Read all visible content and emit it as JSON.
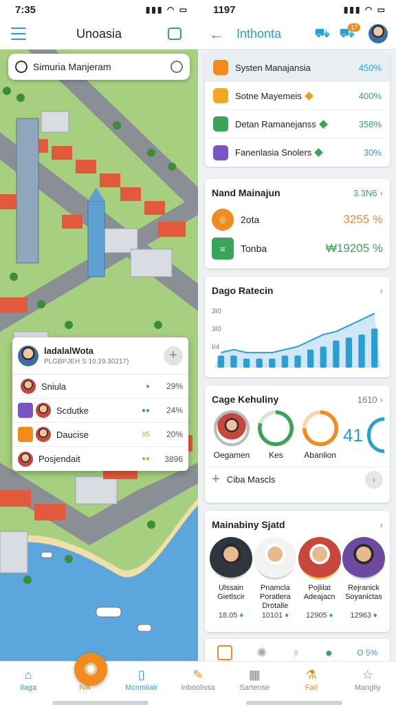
{
  "status": {
    "left_time": "7:35",
    "right_time": "1197"
  },
  "left_header": {
    "title": "Unoasia"
  },
  "right_header": {
    "title": "Inthonta",
    "badge": "17"
  },
  "search": {
    "text": "Simuria Manjeram"
  },
  "popup": {
    "name": "ladalalWota",
    "subtitle": "PLGBPJEH S 10.19.30217)",
    "rows": [
      {
        "label": "Sniula",
        "value": "29%",
        "dot_color": "#888888"
      },
      {
        "label": "Scdutke",
        "value": "24%",
        "dot_color": "#3aa55a",
        "icon_color": "#7b56c2"
      },
      {
        "label": "Daucise",
        "value": "20%",
        "dot_color": "#e8a21c",
        "dot_text": "85",
        "icon_color": "#f28a1d"
      },
      {
        "label": "Posjendait",
        "value": "3896",
        "dot_color": "#e8a21c"
      }
    ]
  },
  "systems": [
    {
      "label": "Systen Manajansia",
      "value": "450%",
      "icon_color": "#f28a1d",
      "value_color": "#2a9fd6"
    },
    {
      "label": "Sotne Mayemeis",
      "value": "400%",
      "icon_color": "#f5a623",
      "value_color": "#3aa55a",
      "diamond_color": "#e8a21c"
    },
    {
      "label": "Detan Ramanejanss",
      "value": "358%",
      "icon_color": "#3aa55a",
      "value_color": "#3aa55a",
      "diamond_color": "#3aa55a"
    },
    {
      "label": "Fanenlasia Snolers",
      "value": "30%",
      "icon_color": "#7b56c2",
      "value_color": "#2a9fd6",
      "diamond_color": "#3aa55a"
    }
  ],
  "main_card": {
    "title": "Nand Mainajun",
    "value": "3.3N6",
    "rows": [
      {
        "label": "2ota",
        "value": "3255 %",
        "icon_color": "#f28a1d",
        "value_color": "#f28a1d"
      },
      {
        "label": "Tonba",
        "value": "₩19205 %",
        "icon_color": "#3aa55a",
        "value_color": "#3aa55a"
      }
    ]
  },
  "chart_card": {
    "title": "Dago Ratecin",
    "ylabels": [
      "3I0",
      "3I0",
      "I/4"
    ]
  },
  "chart_data": {
    "type": "bar",
    "title": "Dago Ratecin",
    "values": [
      2,
      2,
      1.5,
      1.5,
      1.5,
      2,
      2,
      3,
      3.5,
      4.5,
      5,
      5.5,
      6.5
    ],
    "line_values": [
      2.5,
      3,
      2.5,
      2.5,
      2.5,
      3,
      3.5,
      4.5,
      5.5,
      6,
      7,
      8,
      9
    ],
    "color": "#2a9fd6"
  },
  "cage_card": {
    "title": "Cage Kehuliny",
    "value": "1610",
    "rings": [
      {
        "label": "Oegamen",
        "color": "#888888"
      },
      {
        "label": "Kes",
        "color": "#3aa55a",
        "percent": 80
      },
      {
        "label": "Abanlion",
        "color": "#f28a1d",
        "percent": 75
      }
    ],
    "big_number": "41",
    "button": "Ciba Mascls"
  },
  "people_card": {
    "title": "Mainabiny Sjatd",
    "people": [
      {
        "name": "Ulssain Gietlscir",
        "score": "18.05",
        "icon_color": "#2a9fd6"
      },
      {
        "name": "Pnamcla Poratlera Drotalle",
        "score": "10101",
        "icon_color": "#3aa55a"
      },
      {
        "name": "Pojlilat Adeajacn",
        "score": "12905",
        "icon_color": "#2a9fd6"
      },
      {
        "name": "Rejranick Soyanictas",
        "score": "12963",
        "icon_color": "#3aa55a"
      }
    ]
  },
  "bottom_peek": {
    "value": "5%"
  },
  "tabs": [
    {
      "label": "Ilaga",
      "icon": "home-icon",
      "active": true
    },
    {
      "label": "IVA",
      "icon": "sun-icon",
      "active": false
    },
    {
      "label": "Mcnmiiair",
      "icon": "book-icon",
      "active": true
    },
    {
      "label": "Inboolissa",
      "icon": "tag-icon",
      "active": false
    },
    {
      "label": "Sartense",
      "icon": "grid-icon",
      "active": false
    },
    {
      "label": "Fail",
      "icon": "flask-icon",
      "active": false
    },
    {
      "label": "Mangliy",
      "icon": "star-icon",
      "active": false
    }
  ]
}
